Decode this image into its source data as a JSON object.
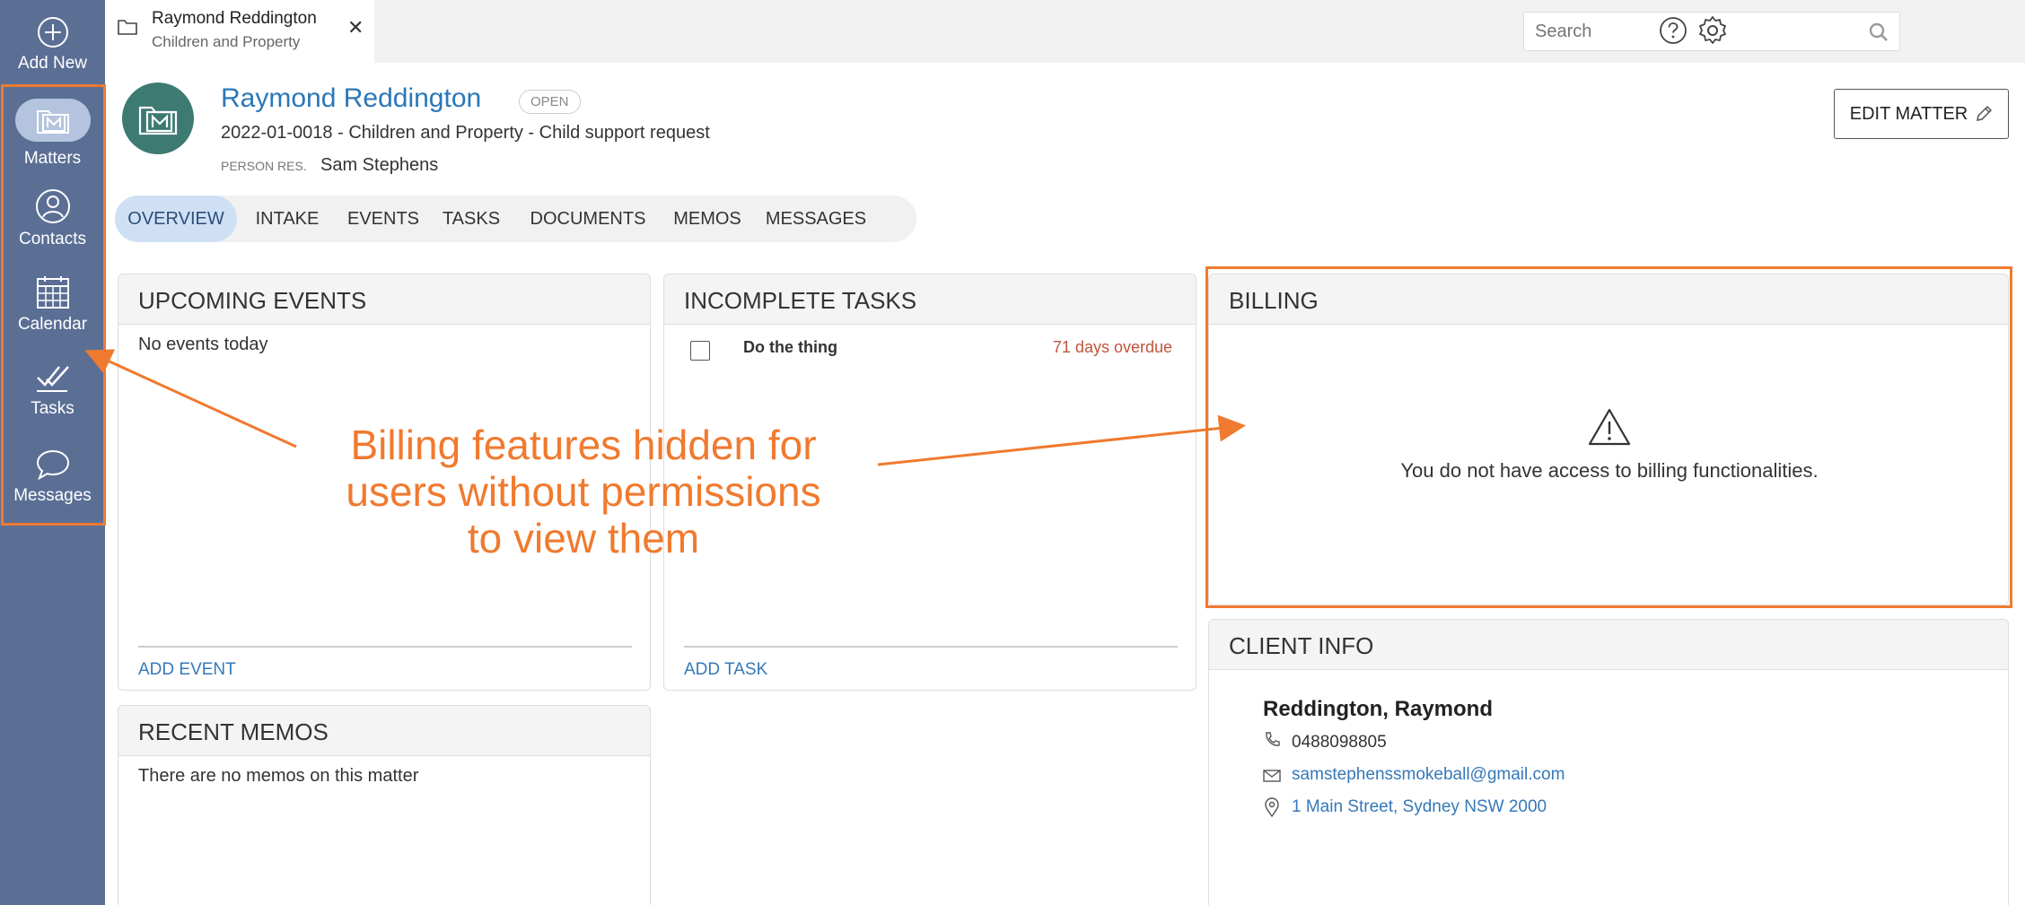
{
  "sidebar": {
    "items": [
      {
        "label": "Add New",
        "icon": "plus-circle-icon"
      },
      {
        "label": "Matters",
        "icon": "matters-icon"
      },
      {
        "label": "Contacts",
        "icon": "contacts-icon"
      },
      {
        "label": "Calendar",
        "icon": "calendar-icon"
      },
      {
        "label": "Tasks",
        "icon": "tasks-icon"
      },
      {
        "label": "Messages",
        "icon": "messages-icon"
      }
    ]
  },
  "topbar": {
    "tab_title": "Raymond Reddington",
    "tab_subtitle": "Children and Property",
    "close_glyph": "✕",
    "search_placeholder": "Search"
  },
  "matter": {
    "name": "Raymond Reddington",
    "status": "OPEN",
    "description": "2022-01-0018 - Children and Property - Child support request",
    "person_label": "PERSON RES.",
    "person_value": "Sam Stephens",
    "edit_label": "EDIT MATTER"
  },
  "tabs": [
    "OVERVIEW",
    "INTAKE",
    "EVENTS",
    "TASKS",
    "DOCUMENTS",
    "MEMOS",
    "MESSAGES"
  ],
  "upcoming_events": {
    "title": "UPCOMING EVENTS",
    "empty_text": "No events today",
    "add_label": "ADD EVENT"
  },
  "incomplete_tasks": {
    "title": "INCOMPLETE TASKS",
    "tasks": [
      {
        "name": "Do the thing",
        "status": "71 days overdue"
      }
    ],
    "add_label": "ADD TASK"
  },
  "billing": {
    "title": "BILLING",
    "message": "You do not have access to billing functionalities."
  },
  "recent_memos": {
    "title": "RECENT MEMOS",
    "empty_text": "There are no memos on this matter"
  },
  "client_info": {
    "title": "CLIENT INFO",
    "name": "Reddington, Raymond",
    "phone": "0488098805",
    "email": "samstephenssmokeball@gmail.com",
    "address": "1 Main Street, Sydney NSW 2000"
  },
  "annotation": {
    "line1": "Billing features hidden for",
    "line2": "users without permissions",
    "line3": "to view them",
    "color": "#f07a2f"
  },
  "colors": {
    "sidebar": "#5b6f95",
    "accent": "#2a77b8",
    "overdue": "#c0533a",
    "avatar": "#3d7a72"
  }
}
